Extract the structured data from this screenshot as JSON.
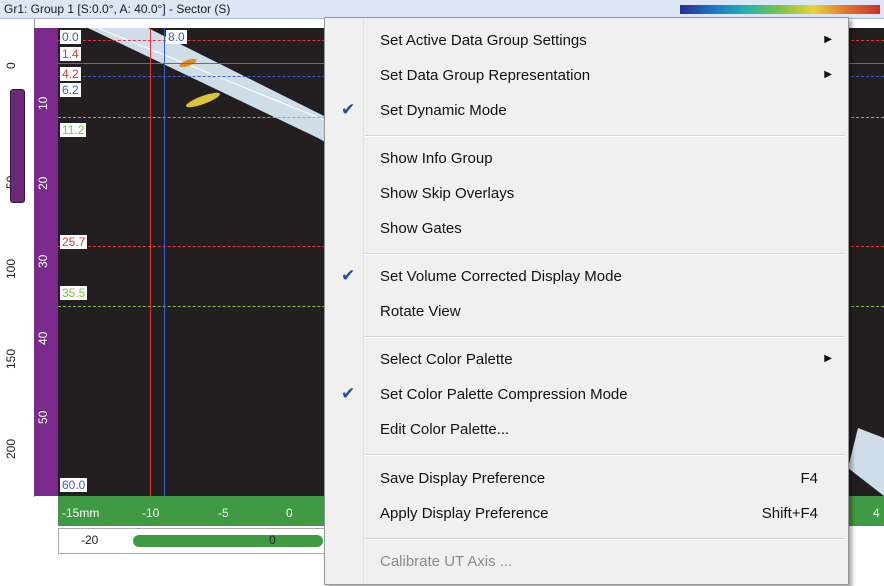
{
  "window": {
    "title": "Gr1: Group 1 [S:0.0°, A: 40.0°] - Sector (S)"
  },
  "left_ruler": {
    "labels": [
      "0",
      "50",
      "100",
      "150",
      "200"
    ]
  },
  "depth_ruler": {
    "labels": [
      "10",
      "20",
      "30",
      "40",
      "50"
    ]
  },
  "gate_tags": {
    "t0": "0.0",
    "t1": "1.4",
    "t2": "4.2",
    "t3": "6.2",
    "t4": "11.2",
    "t5": "25.7",
    "t6": "35.5",
    "t7": "60.0",
    "top_cursor": "8.0"
  },
  "bottom_ruler": {
    "labels": [
      "-15mm",
      "-10",
      "-5",
      "0",
      "4"
    ]
  },
  "bottom_bar": {
    "left_value": "-20",
    "center_value": "0"
  },
  "context_menu": {
    "items": [
      {
        "label": "Set Active Data Group Settings",
        "submenu": true
      },
      {
        "label": "Set Data Group Representation",
        "submenu": true
      },
      {
        "label": "Set Dynamic Mode",
        "checked": true
      },
      {
        "label": "Show Info Group"
      },
      {
        "label": "Show Skip Overlays"
      },
      {
        "label": "Show Gates"
      },
      {
        "label": "Set Volume Corrected Display Mode",
        "checked": true
      },
      {
        "label": "Rotate View"
      },
      {
        "label": "Select Color Palette",
        "submenu": true
      },
      {
        "label": "Set Color Palette Compression Mode",
        "checked": true
      },
      {
        "label": "Edit Color Palette..."
      },
      {
        "label": "Save Display Preference",
        "shortcut": "F4"
      },
      {
        "label": "Apply Display Preference",
        "shortcut": "Shift+F4"
      },
      {
        "label": "Calibrate UT Axis ...",
        "disabled": true
      }
    ]
  },
  "colors": {
    "menu_bg": "#f0f0f0",
    "check": "#1b4fa8",
    "gate_red": "#e03a3a",
    "gate_blue": "#3a5fcf",
    "gate_green": "#7fc34a",
    "ruler_purple": "#7a2a8a",
    "ruler_green": "#3f9a43"
  }
}
